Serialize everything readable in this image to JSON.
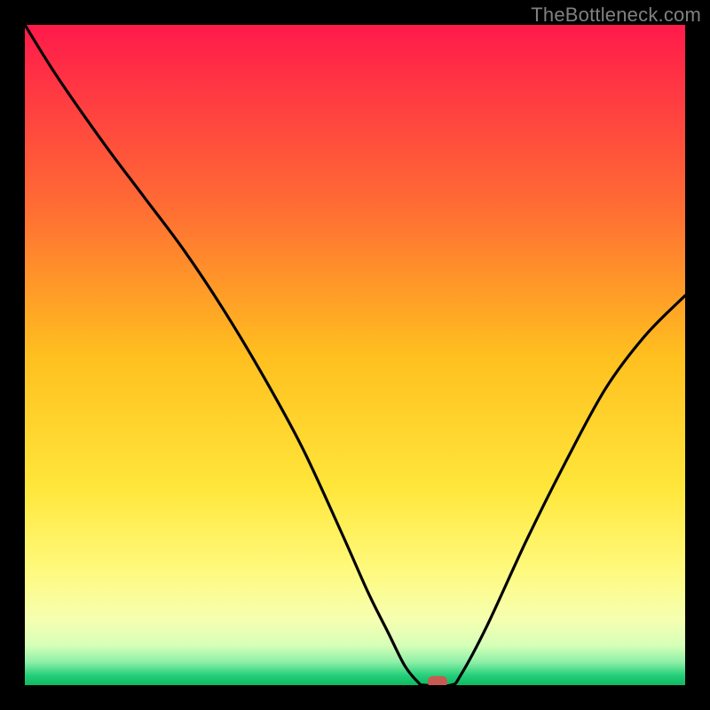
{
  "header": {
    "watermark": "TheBottleneck.com"
  },
  "chart_data": {
    "type": "line",
    "title": "",
    "xlabel": "",
    "ylabel": "",
    "xlim": [
      0,
      100
    ],
    "ylim": [
      0,
      100
    ],
    "grid": false,
    "legend": false,
    "background_gradient": {
      "stops": [
        {
          "offset": 0.0,
          "color": "#ff1a4b"
        },
        {
          "offset": 0.28,
          "color": "#ff6e33"
        },
        {
          "offset": 0.5,
          "color": "#ffbf1f"
        },
        {
          "offset": 0.7,
          "color": "#ffe63a"
        },
        {
          "offset": 0.82,
          "color": "#fff97a"
        },
        {
          "offset": 0.9,
          "color": "#f6ffb0"
        },
        {
          "offset": 0.94,
          "color": "#d6ffb8"
        },
        {
          "offset": 0.965,
          "color": "#8ef0a8"
        },
        {
          "offset": 0.985,
          "color": "#25d07a"
        },
        {
          "offset": 1.0,
          "color": "#0fb85f"
        }
      ]
    },
    "series": [
      {
        "name": "bottleneck-curve",
        "x": [
          0,
          5,
          12,
          18,
          24,
          30,
          36,
          42,
          48,
          52,
          55,
          57.5,
          59.5,
          60.5,
          64.5,
          66,
          70,
          76,
          82,
          88,
          94,
          100
        ],
        "y": [
          100,
          92,
          82,
          74,
          66,
          57,
          47,
          36,
          23,
          14,
          8,
          3,
          0.5,
          0,
          0,
          1.5,
          9,
          22,
          34,
          45,
          53,
          59
        ]
      }
    ],
    "marker": {
      "name": "optimal-point",
      "x": 62.5,
      "y": 0.5,
      "color": "#c75a52"
    }
  }
}
